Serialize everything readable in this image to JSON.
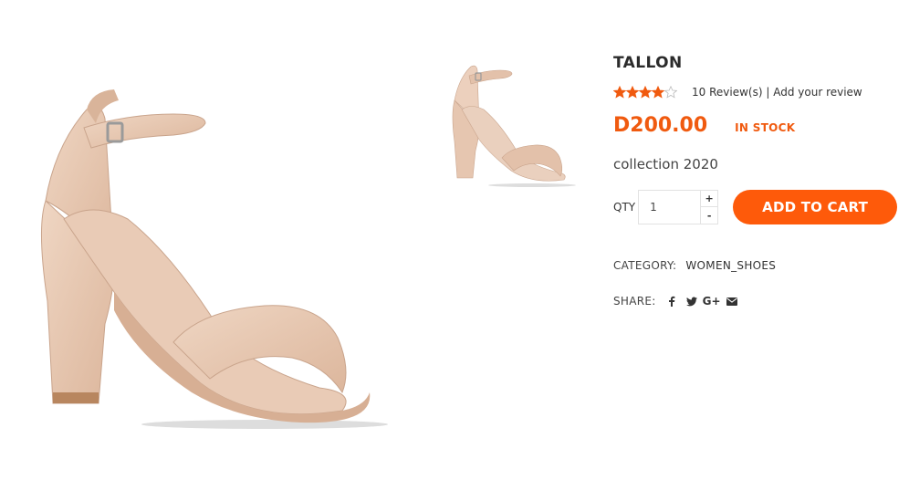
{
  "product": {
    "title": "TALLON",
    "rating": 4,
    "rating_max": 5,
    "reviews_text": "10 Review(s)",
    "separator": "|",
    "add_review_text": "Add your review",
    "price": "D200.00",
    "stock": "IN STOCK",
    "subtitle": "collection 2020",
    "image_color": "#e8c7b0"
  },
  "cart": {
    "qty_label": "QTY",
    "qty_value": "1",
    "plus": "+",
    "minus": "-",
    "add_to_cart": "ADD TO CART"
  },
  "category": {
    "label": "CATEGORY:",
    "value": "WOMEN_SHOES"
  },
  "share": {
    "label": "SHARE:",
    "icons": [
      "facebook-icon",
      "twitter-icon",
      "google-plus-icon",
      "email-icon"
    ],
    "google_plus_text": "G+"
  },
  "colors": {
    "accent": "#fe5a0a",
    "price": "#f05a0f",
    "star": "#f05a0f"
  }
}
